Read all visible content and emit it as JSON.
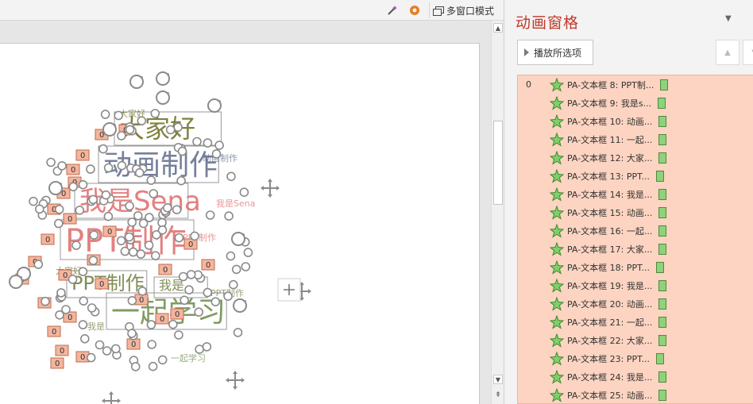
{
  "toolbar": {
    "magic_icon": "magic-wand-icon",
    "settings_icon": "gear-icon",
    "multi_window_label": "多窗口模式",
    "multi_window_icon": "window-icon"
  },
  "slide": {
    "texts": [
      {
        "t": "大家好",
        "c": "#6b6b1f"
      },
      {
        "t": "动画制作",
        "c": "#5f6b8a"
      },
      {
        "t": "我是Sena",
        "c": "#e06b6b"
      },
      {
        "t": "PPT制作",
        "c": "#e06b6b"
      },
      {
        "t": "PPT制作",
        "c": "#6b7a3a"
      },
      {
        "t": "一起学习",
        "c": "#6b8a4a"
      },
      {
        "t": "我是",
        "c": "#6b7a3a"
      }
    ],
    "tag": "0"
  },
  "scrollbar": {
    "up": "▲",
    "down": "▼",
    "jump": "⇞"
  },
  "pane": {
    "title": "动画窗格",
    "menu": "▼",
    "play_label": "播放所选项",
    "up_label": "▲",
    "down_label": "▼",
    "accent": "#c0392b",
    "items": [
      {
        "num": "0",
        "label": "PA-文本框 8: PPT制...",
        "bar": 0.45
      },
      {
        "num": "",
        "label": "PA-文本框 9: 我是s...",
        "bar": 0.55
      },
      {
        "num": "",
        "label": "PA-文本框 10: 动画...",
        "bar": 0.45
      },
      {
        "num": "",
        "label": "PA-文本框 11: 一起...",
        "bar": 0.45
      },
      {
        "num": "",
        "label": "PA-文本框 12: 大家...",
        "bar": 0.45
      },
      {
        "num": "",
        "label": "PA-文本框 13: PPT...",
        "bar": 0.45
      },
      {
        "num": "",
        "label": "PA-文本框 14: 我是...",
        "bar": 0.45
      },
      {
        "num": "",
        "label": "PA-文本框 15: 动画...",
        "bar": 0.45
      },
      {
        "num": "",
        "label": "PA-文本框 16: 一起...",
        "bar": 0.45
      },
      {
        "num": "",
        "label": "PA-文本框 17: 大家...",
        "bar": 0.45
      },
      {
        "num": "",
        "label": "PA-文本框 18: PPT...",
        "bar": 0.45
      },
      {
        "num": "",
        "label": "PA-文本框 19: 我是...",
        "bar": 0.45
      },
      {
        "num": "",
        "label": "PA-文本框 20: 动画...",
        "bar": 0.45
      },
      {
        "num": "",
        "label": "PA-文本框 21: 一起...",
        "bar": 0.45
      },
      {
        "num": "",
        "label": "PA-文本框 22: 大家...",
        "bar": 0.45
      },
      {
        "num": "",
        "label": "PA-文本框 23: PPT...",
        "bar": 0.45
      },
      {
        "num": "",
        "label": "PA-文本框 24: 我是...",
        "bar": 0.45
      },
      {
        "num": "",
        "label": "PA-文本框 25: 动画...",
        "bar": 0.45
      }
    ]
  }
}
